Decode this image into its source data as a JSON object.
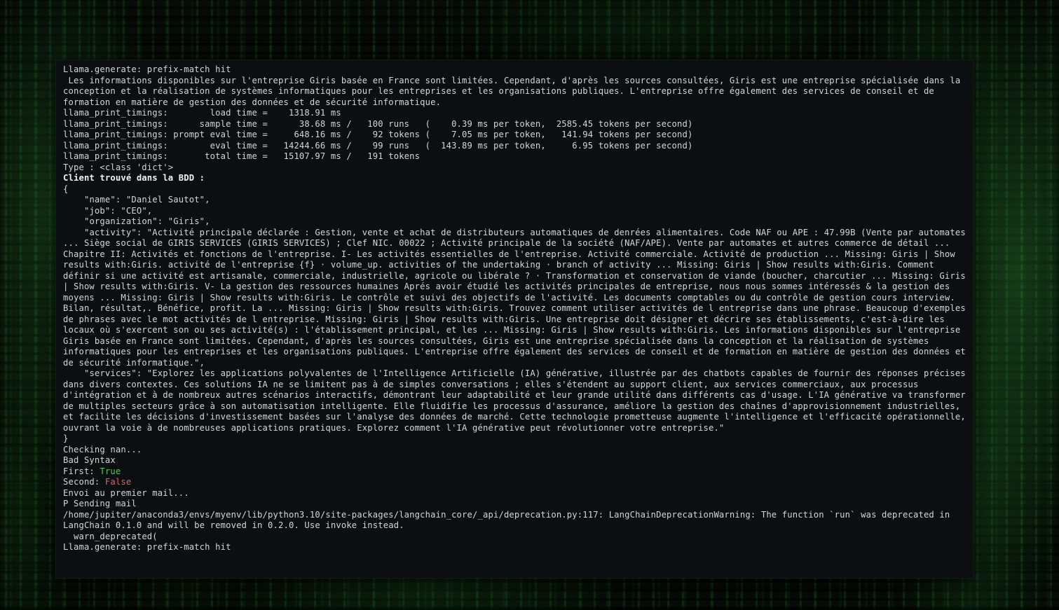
{
  "window": {
    "kind": "terminal-console",
    "background_color": "#0b0f12",
    "default_text_color": "#d2d8d2",
    "accent_true_color": "#56c45a",
    "accent_false_color": "#e0606b",
    "wallpaper": "matrix-green-code-rain"
  },
  "console": {
    "lines": [
      {
        "id": "l01",
        "style": "default",
        "text": "Llama.generate: prefix-match hit"
      },
      {
        "id": "l02",
        "style": "default",
        "text": " Les informations disponibles sur l'entreprise Giris basée en France sont limitées. Cependant, d'après les sources consultées, Giris est une entreprise spécialisée dans la conception et la réalisation de systèmes informatiques pour les entreprises et les organisations publiques. L'entreprise offre également des services de conseil et de formation en matière de gestion des données et de sécurité informatique."
      },
      {
        "id": "l03",
        "style": "default",
        "text": "llama_print_timings:        load time =    1318.91 ms"
      },
      {
        "id": "l04",
        "style": "default",
        "text": "llama_print_timings:      sample time =      38.68 ms /   100 runs   (    0.39 ms per token,  2585.45 tokens per second)"
      },
      {
        "id": "l05",
        "style": "default",
        "text": "llama_print_timings: prompt eval time =     648.16 ms /    92 tokens (    7.05 ms per token,   141.94 tokens per second)"
      },
      {
        "id": "l06",
        "style": "default",
        "text": "llama_print_timings:        eval time =   14244.66 ms /    99 runs   (  143.89 ms per token,     6.95 tokens per second)"
      },
      {
        "id": "l07",
        "style": "default",
        "text": "llama_print_timings:       total time =   15107.97 ms /   191 tokens"
      },
      {
        "id": "l08",
        "style": "default",
        "text": "Type : <class 'dict'>"
      },
      {
        "id": "l09",
        "style": "bold",
        "text": "Client trouvé dans la BDD :"
      },
      {
        "id": "l10",
        "style": "default",
        "text": "{"
      },
      {
        "id": "l11",
        "style": "default",
        "text": "    \"name\": \"Daniel Sautot\","
      },
      {
        "id": "l12",
        "style": "default",
        "text": "    \"job\": \"CEO\","
      },
      {
        "id": "l13",
        "style": "default",
        "text": "    \"organization\": \"Giris\","
      },
      {
        "id": "l14",
        "style": "default",
        "text": "    \"activity\": \"Activité principale déclarée : Gestion, vente et achat de distributeurs automatiques de denrées alimentaires. Code NAF ou APE : 47.99B (Vente par automates ... Siège social de GIRIS SERVICES (GIRIS SERVICES) ; Clef NIC. 00022 ; Activité principale de la société (NAF/APE). Vente par automates et autres commerce de détail ... Chapitre II: Activités et fonctions de l'entreprise. I- Les activités essentielles de l'entreprise. Activité commerciale. Activité de production ... Missing: Giris | Show results with:Giris. activité de l'entreprise {f} · volume_up. activities of the undertaking · branch of activity ... Missing: Giris | Show results with:Giris. Comment définir si une activité est artisanale, commerciale, industrielle, agricole ou libérale ? · Transformation et conservation de viande (boucher, charcutier ... Missing: Giris | Show results with:Giris. V- La gestion des ressources humaines Aprés avoir étudié les activités principales de entreprise, nous nous sommes intéressés & la gestion des moyens ... Missing: Giris | Show results with:Giris. Le contrôle et suivi des objectifs de l'activité. Les documents comptables ou du contrôle de gestion cours interview. Bilan, résultat,. Bénéfice, profit. La ... Missing: Giris | Show results with:Giris. Trouvez comment utiliser activités de l entreprise dans une phrase. Beaucoup d'exemples de phrases avec le mot activités de l entreprise. Missing: Giris | Show results with:Giris. Une entreprise doit désigner et décrire ses établissements, c'est-à-dire les locaux où s'exercent son ou ses activité(s) : l'établissement principal, et les ... Missing: Giris | Show results with:Giris. Les informations disponibles sur l'entreprise Giris basée en France sont limitées. Cependant, d'après les sources consultées, Giris est une entreprise spécialisée dans la conception et la réalisation de systèmes informatiques pour les entreprises et les organisations publiques. L'entreprise offre également des services de conseil et de formation en matière de gestion des données et de sécurité informatique.\","
      },
      {
        "id": "l15",
        "style": "default",
        "text": "    \"services\": \"Explorez les applications polyvalentes de l'Intelligence Artificielle (IA) générative, illustrée par des chatbots capables de fournir des réponses précises dans divers contextes. Ces solutions IA ne se limitent pas à de simples conversations ; elles s'étendent au support client, aux services commerciaux, aux processus d'intégration et à de nombreux autres scénarios interactifs, démontrant leur adaptabilité et leur grande utilité dans différents cas d'usage. L'IA générative va transformer de multiples secteurs grâce à son automatisation intelligente. Elle fluidifie les processus d'assurance, améliore la gestion des chaînes d'approvisionnement industrielles, et facilite les décisions d'investissement basées sur l'analyse des données de marché. Cette technologie prometteuse augmente l'intelligence et l'efficacité opérationnelle, ouvrant la voie à de nombreuses applications pratiques. Explorez comment l'IA générative peut révolutionner votre entreprise.\""
      },
      {
        "id": "l16",
        "style": "default",
        "text": "}"
      },
      {
        "id": "l17",
        "style": "default",
        "text": "Checking nan..."
      },
      {
        "id": "l18",
        "style": "default",
        "text": "Bad Syntax"
      },
      {
        "id": "l19",
        "style": "mixed",
        "parts": [
          {
            "text": "First: ",
            "style": "default"
          },
          {
            "text": "True",
            "style": "green"
          }
        ]
      },
      {
        "id": "l20",
        "style": "mixed",
        "parts": [
          {
            "text": "Second: ",
            "style": "default"
          },
          {
            "text": "False",
            "style": "red"
          }
        ]
      },
      {
        "id": "l21",
        "style": "default",
        "text": "Envoi au premier mail..."
      },
      {
        "id": "l22",
        "style": "default",
        "text": "P Sending mail"
      },
      {
        "id": "l23",
        "style": "default",
        "text": "/home/jupiter/anaconda3/envs/myenv/lib/python3.10/site-packages/langchain_core/_api/deprecation.py:117: LangChainDeprecationWarning: The function `run` was deprecated in LangChain 0.1.0 and will be removed in 0.2.0. Use invoke instead."
      },
      {
        "id": "l24",
        "style": "default",
        "text": "  warn_deprecated("
      },
      {
        "id": "l25",
        "style": "default",
        "text": "Llama.generate: prefix-match hit"
      }
    ]
  },
  "record": {
    "name": "Daniel Sautot",
    "job": "CEO",
    "organization": "Giris"
  },
  "timings": {
    "load_time_ms": "1318.91",
    "sample_time_ms": "38.68",
    "sample_runs": "100",
    "sample_ms_per_token": "0.39",
    "sample_tokens_per_second": "2585.45",
    "prompt_eval_time_ms": "648.16",
    "prompt_eval_tokens": "92",
    "prompt_eval_ms_per_token": "7.05",
    "prompt_eval_tokens_per_second": "141.94",
    "eval_time_ms": "14244.66",
    "eval_runs": "99",
    "eval_ms_per_token": "143.89",
    "eval_tokens_per_second": "6.95",
    "total_time_ms": "15107.97",
    "total_tokens": "191"
  },
  "flags": {
    "first_label": "First:",
    "first_value": "True",
    "second_label": "Second:",
    "second_value": "False"
  }
}
